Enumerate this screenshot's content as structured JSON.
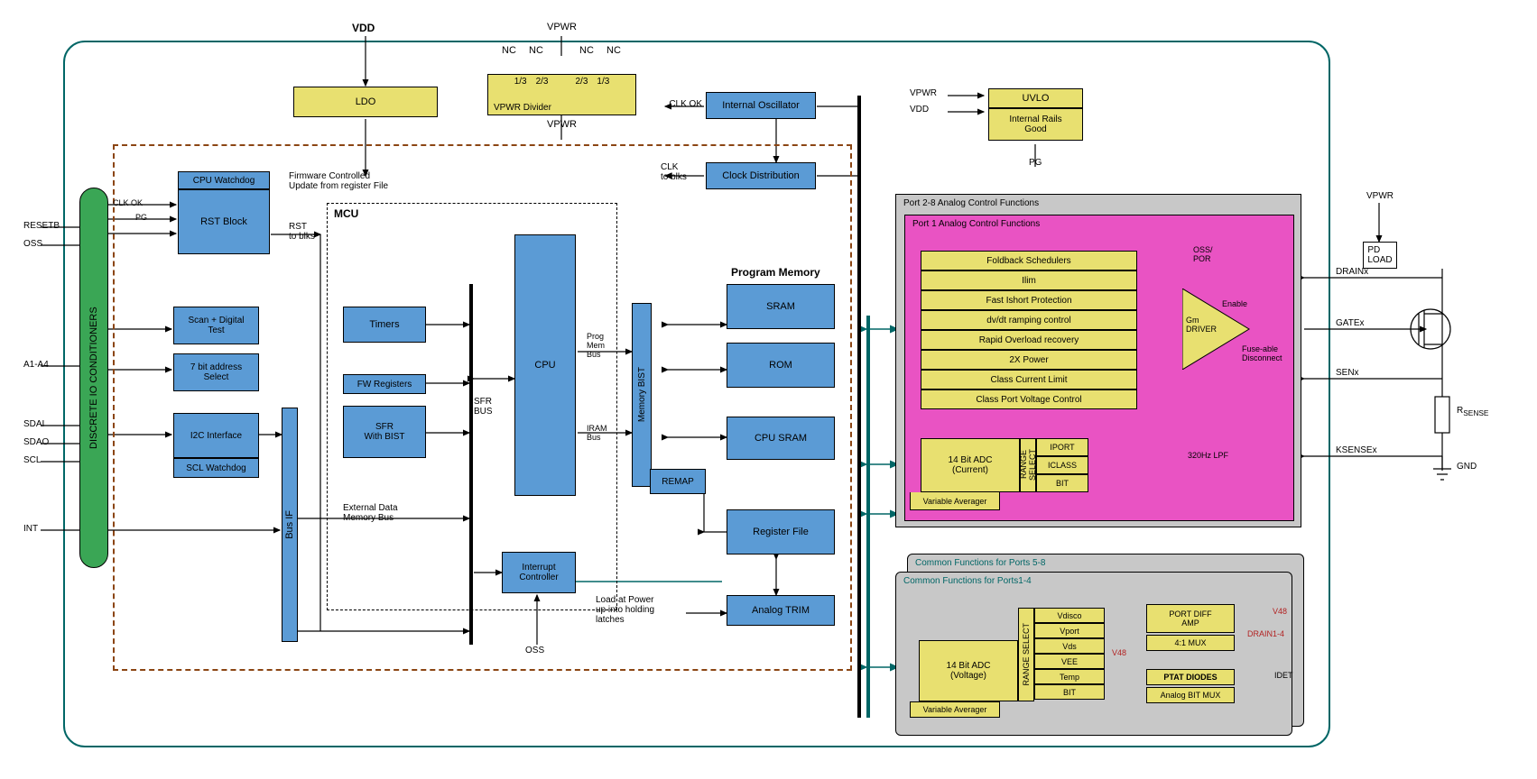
{
  "top_power": {
    "vdd": "VDD",
    "vpwr": "VPWR",
    "nc": "NC",
    "one_third": "1/3",
    "two_third": "2/3",
    "ldo": "LDO",
    "vpwr_div": "VPWR Divider",
    "uvlo": "UVLO",
    "rails_good": "Internal Rails\nGood",
    "pg": "PG"
  },
  "clocks": {
    "int_osc": "Internal Oscillator",
    "clk_ok": "CLK OK",
    "clk_dist": "Clock Distribution",
    "clk_to_blks": "CLK\nto blks"
  },
  "io_pins": {
    "resetb": "RESETB",
    "oss": "OSS",
    "a1a4": "A1-A4",
    "sdai": "SDAI",
    "sdao": "SDAO",
    "scl": "SCL",
    "int": "INT",
    "clk_ok": "CLK OK",
    "pg": "PG"
  },
  "io_cond": "DISCRETE IO CONDITIONERS",
  "rst": {
    "cpu_wd": "CPU Watchdog",
    "rst_block": "RST Block",
    "fw_note": "Firmware Controlled\nUpdate from register File",
    "rst_to_blks": "RST\nto blks"
  },
  "left_stack": {
    "scan": "Scan + Digital\nTest",
    "addr": "7 bit address\nSelect",
    "i2c": "I2C Interface",
    "scl_wd": "SCL Watchdog"
  },
  "bus_if": "Bus IF",
  "mcu": {
    "label": "MCU",
    "timers": "Timers",
    "fw_reg": "FW Registers",
    "sfr_bist": "SFR\nWith BIST",
    "cpu": "CPU",
    "sfr_bus": "SFR\nBUS",
    "prog_bus": "Prog\nMem\nBus",
    "iram_bus": "IRAM\nBus",
    "mem_bist": "Memory BIST",
    "intc": "Interrupt\nController",
    "ext_bus": "External Data\nMemory Bus",
    "oss": "OSS"
  },
  "mem": {
    "label": "Program Memory",
    "sram": "SRAM",
    "rom": "ROM",
    "cpu_sram": "CPU SRAM",
    "remap": "REMAP",
    "regfile": "Register File",
    "atrim": "Analog TRIM",
    "load_note": "Load at Power\nup into holding\nlatches"
  },
  "port_title_back": "Port 2-8 Analog Control Functions",
  "port_title": "Port 1 Analog Control Functions",
  "port_funcs": [
    "Foldback Schedulers",
    "Ilim",
    "Fast Ishort Protection",
    "dv/dt ramping control",
    "Rapid Overload recovery",
    "2X Power",
    "Class Current Limit",
    "Class Port Voltage Control"
  ],
  "gm": {
    "oss_por": "OSS/\nPOR",
    "enable": "Enable",
    "driver": "Gm\nDRIVER",
    "fuse": "Fuse-able\nDisconnect"
  },
  "adc_i": {
    "main": "14 Bit ADC\n(Current)",
    "rsel": "RANGE\nSELECT",
    "iport": "IPORT",
    "iclass": "ICLASS",
    "bit": "BIT",
    "lpf": "320Hz LPF",
    "avg": "Variable Averager"
  },
  "common": {
    "title58": "Common Functions for Ports 5-8",
    "title14": "Common Functions for Ports1-4",
    "adc_v": "14 Bit ADC\n(Voltage)",
    "rsel": "RANGE SELECT",
    "rows": [
      "Vdisco",
      "Vport",
      "Vds",
      "VEE",
      "Temp",
      "BIT"
    ],
    "port_diff": "PORT DIFF\nAMP",
    "mux": "4:1 MUX",
    "ptat": "PTAT DIODES",
    "abitmux": "Analog BIT MUX",
    "idet": "IDET",
    "v48": "V48",
    "drain14": "DRAIN1-4",
    "avg": "Variable Averager"
  },
  "ext": {
    "vpwr": "VPWR",
    "pdload": "PD\nLOAD",
    "drainx": "DRAINx",
    "gatex": "GATEx",
    "senx": "SENx",
    "ksensex": "KSENSEx",
    "rsense": "RSENSE",
    "gnd": "GND",
    "sub": "SENSE"
  }
}
